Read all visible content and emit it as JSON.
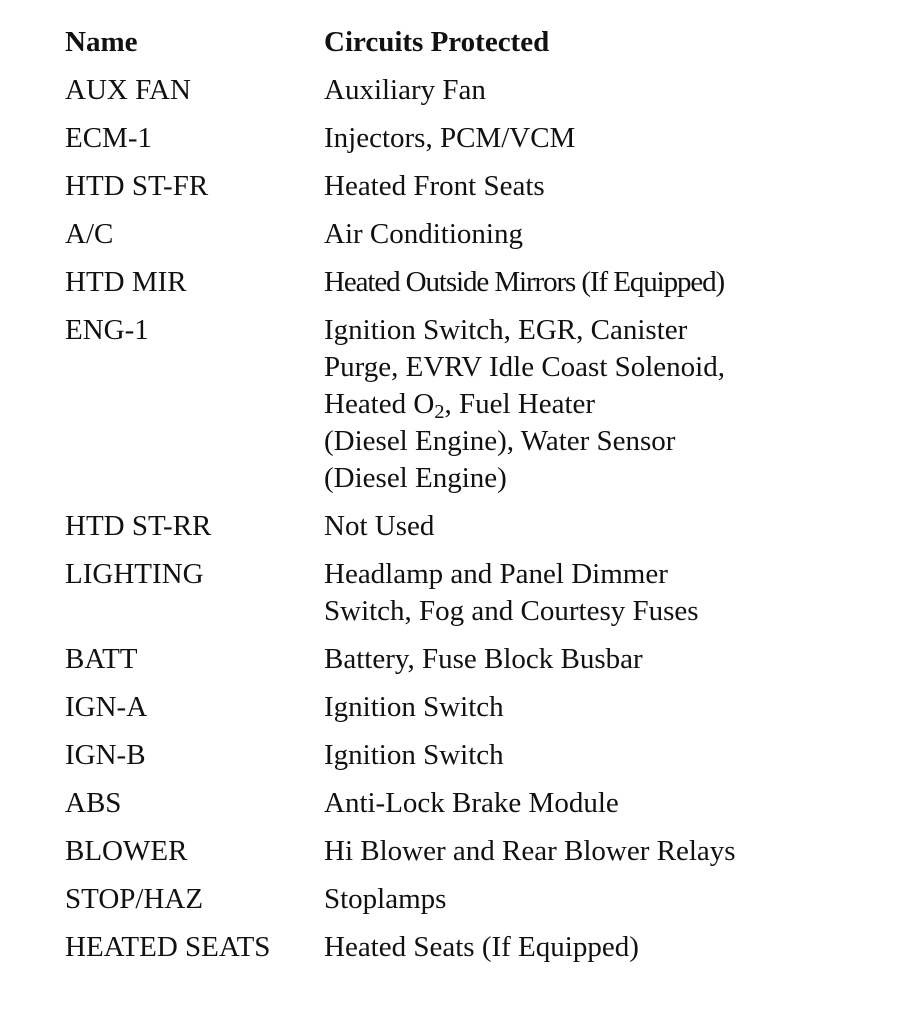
{
  "table": {
    "headers": {
      "name": "Name",
      "circuits": "Circuits Protected"
    },
    "rows": [
      {
        "name": "AUX FAN",
        "circuits": [
          "Auxiliary Fan"
        ]
      },
      {
        "name": "ECM-1",
        "circuits": [
          "Injectors, PCM/VCM"
        ]
      },
      {
        "name": "HTD ST-FR",
        "circuits": [
          "Heated Front Seats"
        ]
      },
      {
        "name": "A/C",
        "circuits": [
          "Air Conditioning"
        ]
      },
      {
        "name": "HTD MIR",
        "circuits": [
          "Heated Outside Mirrors (If Equipped)"
        ]
      },
      {
        "name": "ENG-1",
        "circuits": [
          "Ignition Switch, EGR, Canister",
          "Purge, EVRV Idle Coast Solenoid,",
          "Heated O",
          "2",
          ", Fuel Heater",
          "(Diesel Engine), Water Sensor",
          "(Diesel Engine)"
        ]
      },
      {
        "name": "HTD ST-RR",
        "circuits": [
          "Not Used"
        ]
      },
      {
        "name": "LIGHTING",
        "circuits": [
          "Headlamp and Panel Dimmer",
          "Switch, Fog and Courtesy Fuses"
        ]
      },
      {
        "name": "BATT",
        "circuits": [
          "Battery, Fuse Block Busbar"
        ]
      },
      {
        "name": "IGN-A",
        "circuits": [
          "Ignition Switch"
        ]
      },
      {
        "name": "IGN-B",
        "circuits": [
          "Ignition Switch"
        ]
      },
      {
        "name": "ABS",
        "circuits": [
          "Anti-Lock Brake Module"
        ]
      },
      {
        "name": "BLOWER",
        "circuits": [
          "Hi Blower and Rear Blower Relays"
        ]
      },
      {
        "name": "STOP/HAZ",
        "circuits": [
          "Stoplamps"
        ]
      },
      {
        "name": "HEATED SEATS",
        "circuits": [
          "Heated Seats (If Equipped)"
        ]
      }
    ]
  }
}
